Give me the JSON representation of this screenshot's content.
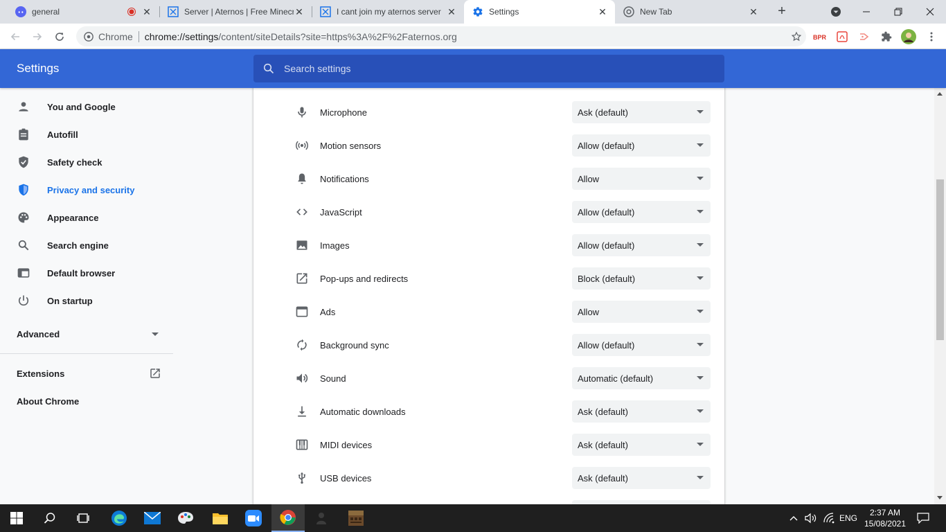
{
  "browser": {
    "tabs": [
      {
        "title": "general",
        "active": false
      },
      {
        "title": "Server | Aternos | Free Minecraft",
        "active": false
      },
      {
        "title": "I cant join my aternos server",
        "active": false
      },
      {
        "title": "Settings",
        "active": true
      },
      {
        "title": "New Tab",
        "active": false
      }
    ],
    "omnibox": {
      "chip": "Chrome",
      "url_host": "chrome://settings",
      "url_path": "/content/siteDetails?site=https%3A%2F%2Faternos.org"
    }
  },
  "settings": {
    "header_title": "Settings",
    "search_placeholder": "Search settings",
    "nav": [
      {
        "label": "You and Google",
        "icon": "person-icon"
      },
      {
        "label": "Autofill",
        "icon": "clipboard-icon"
      },
      {
        "label": "Safety check",
        "icon": "shield-check-icon"
      },
      {
        "label": "Privacy and security",
        "icon": "shield-icon",
        "selected": true
      },
      {
        "label": "Appearance",
        "icon": "palette-icon"
      },
      {
        "label": "Search engine",
        "icon": "search-icon"
      },
      {
        "label": "Default browser",
        "icon": "browser-window-icon"
      },
      {
        "label": "On startup",
        "icon": "power-icon"
      }
    ],
    "advanced_label": "Advanced",
    "extensions_label": "Extensions",
    "about_label": "About Chrome",
    "permissions": [
      {
        "label": "Microphone",
        "value": "Ask (default)",
        "icon": "microphone-icon"
      },
      {
        "label": "Motion sensors",
        "value": "Allow (default)",
        "icon": "sensors-icon"
      },
      {
        "label": "Notifications",
        "value": "Allow",
        "icon": "bell-icon"
      },
      {
        "label": "JavaScript",
        "value": "Allow (default)",
        "icon": "code-icon"
      },
      {
        "label": "Images",
        "value": "Allow (default)",
        "icon": "image-icon"
      },
      {
        "label": "Pop-ups and redirects",
        "value": "Block (default)",
        "icon": "open-external-icon"
      },
      {
        "label": "Ads",
        "value": "Allow",
        "icon": "ads-window-icon"
      },
      {
        "label": "Background sync",
        "value": "Allow (default)",
        "icon": "sync-icon"
      },
      {
        "label": "Sound",
        "value": "Automatic (default)",
        "icon": "speaker-icon"
      },
      {
        "label": "Automatic downloads",
        "value": "Ask (default)",
        "icon": "download-icon"
      },
      {
        "label": "MIDI devices",
        "value": "Ask (default)",
        "icon": "piano-icon"
      },
      {
        "label": "USB devices",
        "value": "Ask (default)",
        "icon": "usb-icon"
      }
    ]
  },
  "taskbar": {
    "language": "ENG",
    "time": "2:37 AM",
    "date": "15/08/2021"
  },
  "colors": {
    "header_blue": "#3367d6",
    "selected_blue": "#1a73e8",
    "taskbar": "#1f1f1f"
  }
}
